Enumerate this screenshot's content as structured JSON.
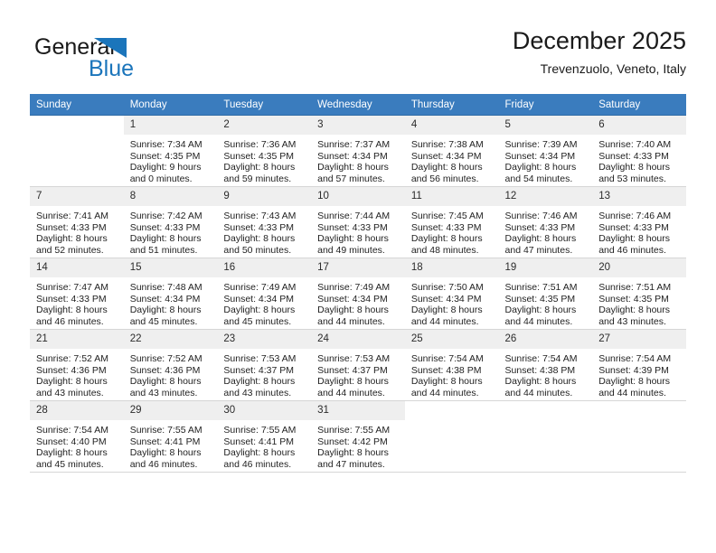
{
  "brand": {
    "name_top": "General",
    "name_bottom": "Blue",
    "accent_color": "#1b75bb",
    "text_color": "#1a1a1a"
  },
  "header": {
    "title": "December 2025",
    "subtitle": "Trevenzuolo, Veneto, Italy"
  },
  "theme": {
    "header_bg": "#3a7cbe",
    "header_text": "#ffffff",
    "daynum_bg": "#efefef",
    "grid_line": "#d6d6d6"
  },
  "weekday_headers": [
    "Sunday",
    "Monday",
    "Tuesday",
    "Wednesday",
    "Thursday",
    "Friday",
    "Saturday"
  ],
  "weeks": [
    [
      {
        "day": "",
        "sunrise": "",
        "sunset": "",
        "daylight_1": "",
        "daylight_2": "",
        "blank": true
      },
      {
        "day": "1",
        "sunrise": "Sunrise: 7:34 AM",
        "sunset": "Sunset: 4:35 PM",
        "daylight_1": "Daylight: 9 hours",
        "daylight_2": "and 0 minutes."
      },
      {
        "day": "2",
        "sunrise": "Sunrise: 7:36 AM",
        "sunset": "Sunset: 4:35 PM",
        "daylight_1": "Daylight: 8 hours",
        "daylight_2": "and 59 minutes."
      },
      {
        "day": "3",
        "sunrise": "Sunrise: 7:37 AM",
        "sunset": "Sunset: 4:34 PM",
        "daylight_1": "Daylight: 8 hours",
        "daylight_2": "and 57 minutes."
      },
      {
        "day": "4",
        "sunrise": "Sunrise: 7:38 AM",
        "sunset": "Sunset: 4:34 PM",
        "daylight_1": "Daylight: 8 hours",
        "daylight_2": "and 56 minutes."
      },
      {
        "day": "5",
        "sunrise": "Sunrise: 7:39 AM",
        "sunset": "Sunset: 4:34 PM",
        "daylight_1": "Daylight: 8 hours",
        "daylight_2": "and 54 minutes."
      },
      {
        "day": "6",
        "sunrise": "Sunrise: 7:40 AM",
        "sunset": "Sunset: 4:33 PM",
        "daylight_1": "Daylight: 8 hours",
        "daylight_2": "and 53 minutes."
      }
    ],
    [
      {
        "day": "7",
        "sunrise": "Sunrise: 7:41 AM",
        "sunset": "Sunset: 4:33 PM",
        "daylight_1": "Daylight: 8 hours",
        "daylight_2": "and 52 minutes."
      },
      {
        "day": "8",
        "sunrise": "Sunrise: 7:42 AM",
        "sunset": "Sunset: 4:33 PM",
        "daylight_1": "Daylight: 8 hours",
        "daylight_2": "and 51 minutes."
      },
      {
        "day": "9",
        "sunrise": "Sunrise: 7:43 AM",
        "sunset": "Sunset: 4:33 PM",
        "daylight_1": "Daylight: 8 hours",
        "daylight_2": "and 50 minutes."
      },
      {
        "day": "10",
        "sunrise": "Sunrise: 7:44 AM",
        "sunset": "Sunset: 4:33 PM",
        "daylight_1": "Daylight: 8 hours",
        "daylight_2": "and 49 minutes."
      },
      {
        "day": "11",
        "sunrise": "Sunrise: 7:45 AM",
        "sunset": "Sunset: 4:33 PM",
        "daylight_1": "Daylight: 8 hours",
        "daylight_2": "and 48 minutes."
      },
      {
        "day": "12",
        "sunrise": "Sunrise: 7:46 AM",
        "sunset": "Sunset: 4:33 PM",
        "daylight_1": "Daylight: 8 hours",
        "daylight_2": "and 47 minutes."
      },
      {
        "day": "13",
        "sunrise": "Sunrise: 7:46 AM",
        "sunset": "Sunset: 4:33 PM",
        "daylight_1": "Daylight: 8 hours",
        "daylight_2": "and 46 minutes."
      }
    ],
    [
      {
        "day": "14",
        "sunrise": "Sunrise: 7:47 AM",
        "sunset": "Sunset: 4:33 PM",
        "daylight_1": "Daylight: 8 hours",
        "daylight_2": "and 46 minutes."
      },
      {
        "day": "15",
        "sunrise": "Sunrise: 7:48 AM",
        "sunset": "Sunset: 4:34 PM",
        "daylight_1": "Daylight: 8 hours",
        "daylight_2": "and 45 minutes."
      },
      {
        "day": "16",
        "sunrise": "Sunrise: 7:49 AM",
        "sunset": "Sunset: 4:34 PM",
        "daylight_1": "Daylight: 8 hours",
        "daylight_2": "and 45 minutes."
      },
      {
        "day": "17",
        "sunrise": "Sunrise: 7:49 AM",
        "sunset": "Sunset: 4:34 PM",
        "daylight_1": "Daylight: 8 hours",
        "daylight_2": "and 44 minutes."
      },
      {
        "day": "18",
        "sunrise": "Sunrise: 7:50 AM",
        "sunset": "Sunset: 4:34 PM",
        "daylight_1": "Daylight: 8 hours",
        "daylight_2": "and 44 minutes."
      },
      {
        "day": "19",
        "sunrise": "Sunrise: 7:51 AM",
        "sunset": "Sunset: 4:35 PM",
        "daylight_1": "Daylight: 8 hours",
        "daylight_2": "and 44 minutes."
      },
      {
        "day": "20",
        "sunrise": "Sunrise: 7:51 AM",
        "sunset": "Sunset: 4:35 PM",
        "daylight_1": "Daylight: 8 hours",
        "daylight_2": "and 43 minutes."
      }
    ],
    [
      {
        "day": "21",
        "sunrise": "Sunrise: 7:52 AM",
        "sunset": "Sunset: 4:36 PM",
        "daylight_1": "Daylight: 8 hours",
        "daylight_2": "and 43 minutes."
      },
      {
        "day": "22",
        "sunrise": "Sunrise: 7:52 AM",
        "sunset": "Sunset: 4:36 PM",
        "daylight_1": "Daylight: 8 hours",
        "daylight_2": "and 43 minutes."
      },
      {
        "day": "23",
        "sunrise": "Sunrise: 7:53 AM",
        "sunset": "Sunset: 4:37 PM",
        "daylight_1": "Daylight: 8 hours",
        "daylight_2": "and 43 minutes."
      },
      {
        "day": "24",
        "sunrise": "Sunrise: 7:53 AM",
        "sunset": "Sunset: 4:37 PM",
        "daylight_1": "Daylight: 8 hours",
        "daylight_2": "and 44 minutes."
      },
      {
        "day": "25",
        "sunrise": "Sunrise: 7:54 AM",
        "sunset": "Sunset: 4:38 PM",
        "daylight_1": "Daylight: 8 hours",
        "daylight_2": "and 44 minutes."
      },
      {
        "day": "26",
        "sunrise": "Sunrise: 7:54 AM",
        "sunset": "Sunset: 4:38 PM",
        "daylight_1": "Daylight: 8 hours",
        "daylight_2": "and 44 minutes."
      },
      {
        "day": "27",
        "sunrise": "Sunrise: 7:54 AM",
        "sunset": "Sunset: 4:39 PM",
        "daylight_1": "Daylight: 8 hours",
        "daylight_2": "and 44 minutes."
      }
    ],
    [
      {
        "day": "28",
        "sunrise": "Sunrise: 7:54 AM",
        "sunset": "Sunset: 4:40 PM",
        "daylight_1": "Daylight: 8 hours",
        "daylight_2": "and 45 minutes."
      },
      {
        "day": "29",
        "sunrise": "Sunrise: 7:55 AM",
        "sunset": "Sunset: 4:41 PM",
        "daylight_1": "Daylight: 8 hours",
        "daylight_2": "and 46 minutes."
      },
      {
        "day": "30",
        "sunrise": "Sunrise: 7:55 AM",
        "sunset": "Sunset: 4:41 PM",
        "daylight_1": "Daylight: 8 hours",
        "daylight_2": "and 46 minutes."
      },
      {
        "day": "31",
        "sunrise": "Sunrise: 7:55 AM",
        "sunset": "Sunset: 4:42 PM",
        "daylight_1": "Daylight: 8 hours",
        "daylight_2": "and 47 minutes."
      },
      {
        "day": "",
        "sunrise": "",
        "sunset": "",
        "daylight_1": "",
        "daylight_2": "",
        "blank": true
      },
      {
        "day": "",
        "sunrise": "",
        "sunset": "",
        "daylight_1": "",
        "daylight_2": "",
        "blank": true
      },
      {
        "day": "",
        "sunrise": "",
        "sunset": "",
        "daylight_1": "",
        "daylight_2": "",
        "blank": true
      }
    ]
  ]
}
